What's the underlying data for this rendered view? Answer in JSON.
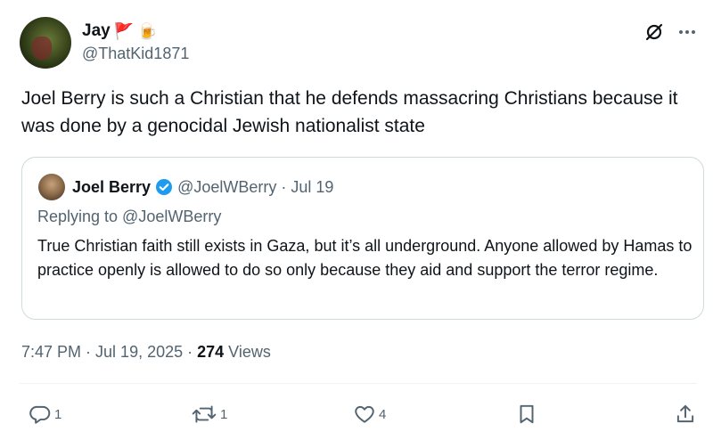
{
  "author": {
    "display_name": "Jay",
    "emojis": [
      "🚩",
      "🍺"
    ],
    "handle": "@ThatKid1871"
  },
  "tweet_text": "Joel Berry is such a Christian that he defends massacring Christians because it was done by a genocidal Jewish nationalist state",
  "quoted": {
    "display_name": "Joel Berry",
    "handle": "@JoelWBerry",
    "separator": "·",
    "date": "Jul 19",
    "replying_to": "Replying to @JoelWBerry",
    "text": "True Christian faith still exists in Gaza, but it’s all underground. Anyone allowed by Hamas to practice openly is allowed to do so only because they aid and support the terror regime."
  },
  "meta": {
    "time": "7:47 PM",
    "sep1": "·",
    "date": "Jul 19, 2025",
    "sep2": "·",
    "views_count": "274",
    "views_label": "Views"
  },
  "actions": {
    "replies": "1",
    "reposts": "1",
    "likes": "4"
  },
  "colors": {
    "text": "#0f1419",
    "secondary": "#536471",
    "border": "#cfd9de",
    "verified": "#1d9bf0"
  }
}
